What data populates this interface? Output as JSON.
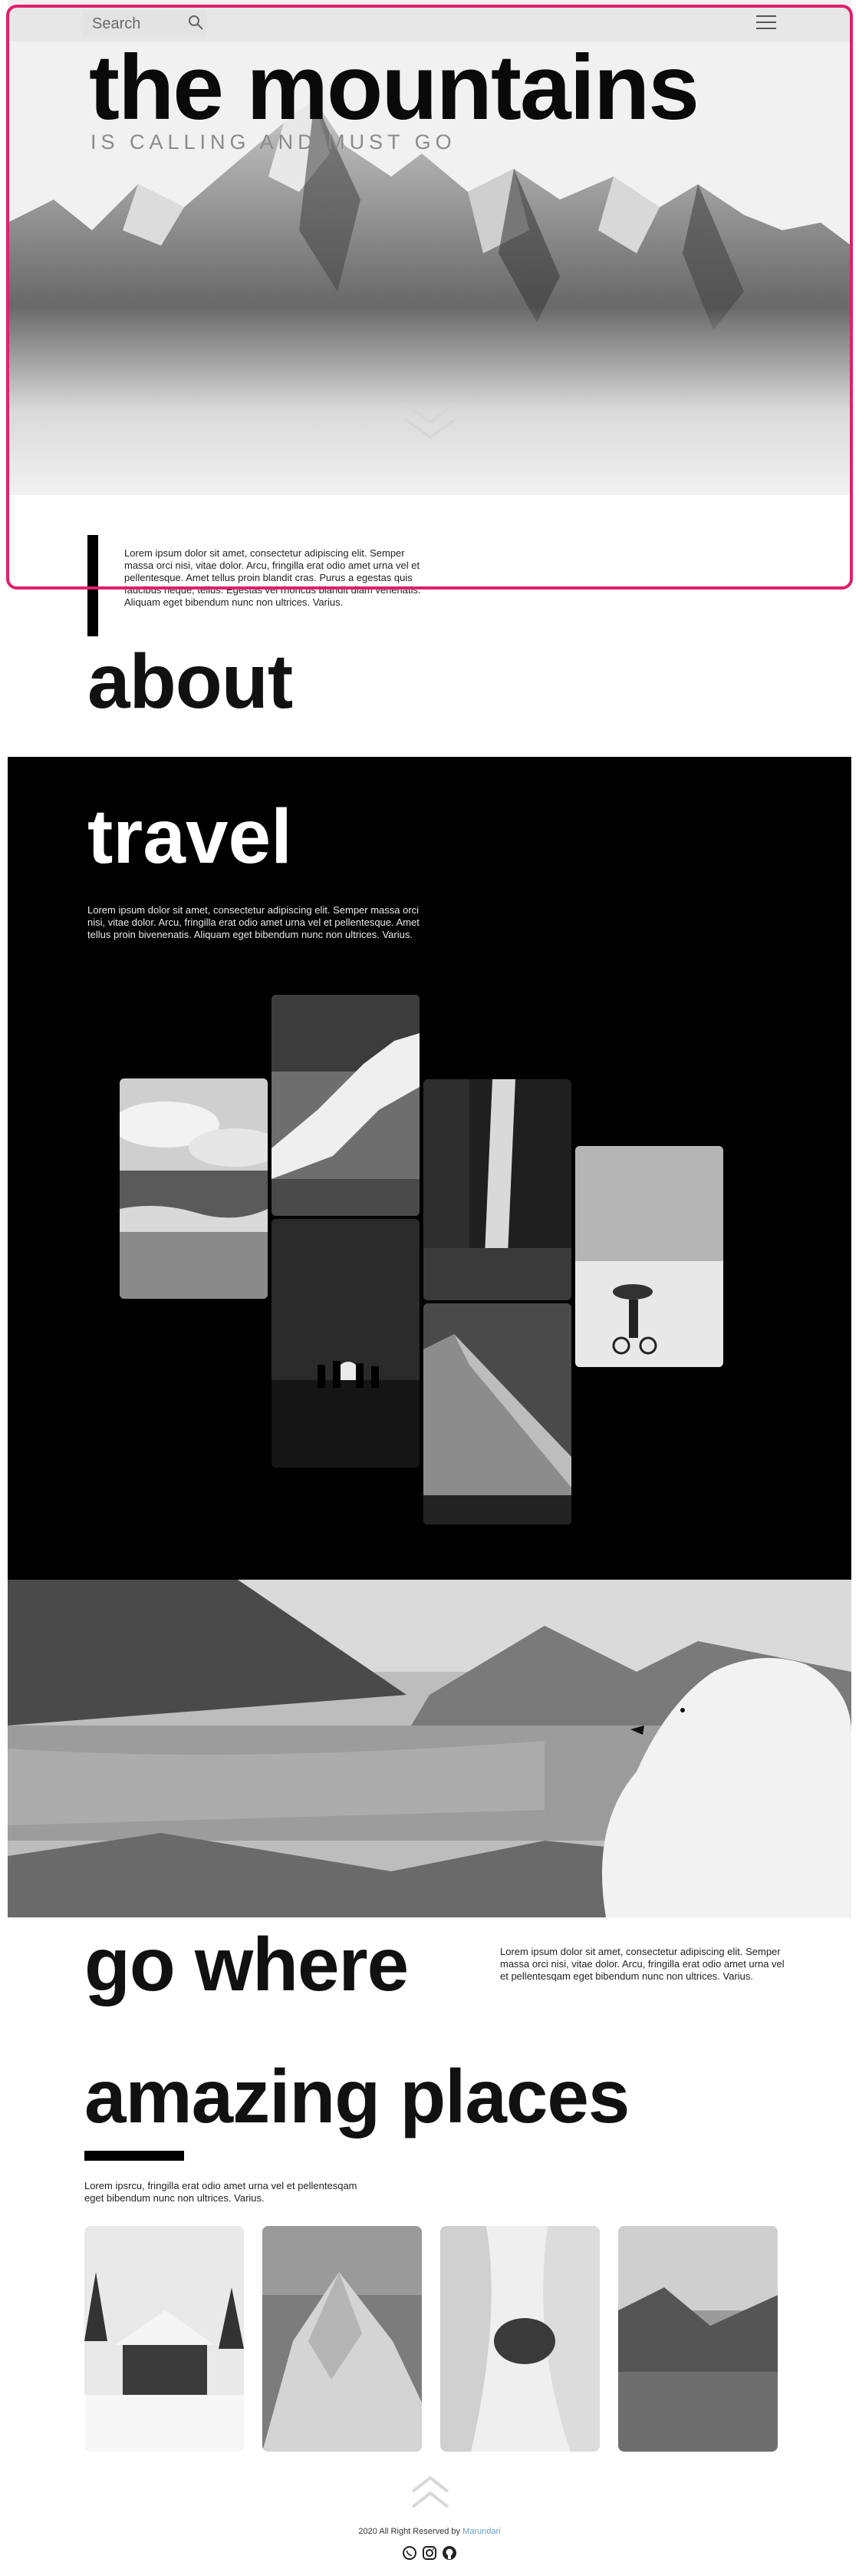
{
  "header": {
    "search_placeholder": "Search",
    "search_icon": "search-icon",
    "menu_icon": "hamburger-menu-icon"
  },
  "hero": {
    "title": "the mountains",
    "subtitle": "IS CALLING AND MUST GO",
    "scroll_icon": "double-chevron-down-icon"
  },
  "about": {
    "text": "Lorem ipsum dolor sit amet, consectetur adipiscing elit. Semper massa orci nisi, vitae dolor. Arcu, fringilla erat odio amet urna vel et pellentesque. Amet tellus proin blandit cras. Purus a egestas quis faucibus neque, tellus. Egestas vel rhoncus blandit diam venenatis. Aliquam eget bibendum nunc non ultrices. Varius.",
    "title": "about"
  },
  "travel": {
    "title": "travel",
    "text": "Lorem ipsum dolor sit amet, consectetur adipiscing elit. Semper massa orci nisi, vitae dolor. Arcu, fringilla erat odio amet urna vel et pellentesque. Amet tellus proin bivenenatis. Aliquam eget bibendum nunc non ultrices. Varius.",
    "gallery": [
      "beach-photo",
      "ocean-wave-photo",
      "sunset-people-photo",
      "waterfall-photo",
      "mountain-slope-photo",
      "snow-cyclist-photo"
    ]
  },
  "go_where": {
    "title": "go where",
    "text": "Lorem ipsum dolor sit amet, consectetur adipiscing elit. Semper massa orci nisi, vitae dolor. Arcu, fringilla erat odio amet urna vel et pellentesqam eget bibendum nunc non ultrices. Varius."
  },
  "amazing": {
    "title": "amazing places",
    "text": "Lorem ipsrcu, fringilla erat odio amet urna vel et pellentesqam eget bibendum nunc non ultrices. Varius.",
    "cards": [
      "snow-cabin-photo",
      "rocky-peak-photo",
      "snow-aerial-photo",
      "lake-fjord-photo"
    ]
  },
  "footer": {
    "back_to_top_icon": "double-chevron-up-icon",
    "copyright": "2020 All Right Reserved by",
    "author": "Marundari",
    "social": [
      "whatsapp-icon",
      "instagram-icon",
      "github-icon"
    ]
  },
  "colors": {
    "accent_frame": "#e0206b",
    "dark": "#000000",
    "author_link": "#6aa0c8"
  }
}
